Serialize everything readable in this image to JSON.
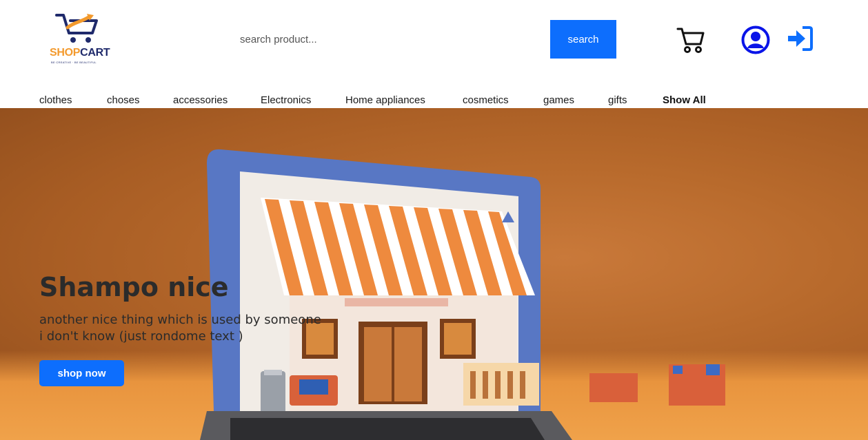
{
  "brand": {
    "name_part1": "SHOP",
    "name_part2": "CART",
    "tagline": "BE CREATIVE · BE BEAUTIFUL",
    "colors": {
      "orange": "#f39a2d",
      "navy": "#1f2a6b"
    }
  },
  "search": {
    "placeholder": "search product...",
    "value": "",
    "button_label": "search"
  },
  "header_icons": {
    "cart": "cart-icon",
    "user": "user-circle-icon",
    "login": "sign-in-icon"
  },
  "nav": {
    "items": [
      {
        "label": "clothes"
      },
      {
        "label": "choses"
      },
      {
        "label": "accessories"
      },
      {
        "label": "Electronics"
      },
      {
        "label": "Home appliances"
      },
      {
        "label": "cosmetics"
      },
      {
        "label": "games"
      },
      {
        "label": "gifts"
      },
      {
        "label": "Show All"
      }
    ]
  },
  "hero": {
    "title": "Shampo nice",
    "subtitle_line1": "another nice thing which is used by someone",
    "subtitle_line2": "i don't know (just rondome text )",
    "cta_label": "shop now"
  },
  "colors": {
    "primary": "#0d6efd",
    "user_icon": "#0a14e8",
    "login_icon": "#0d6efd"
  }
}
